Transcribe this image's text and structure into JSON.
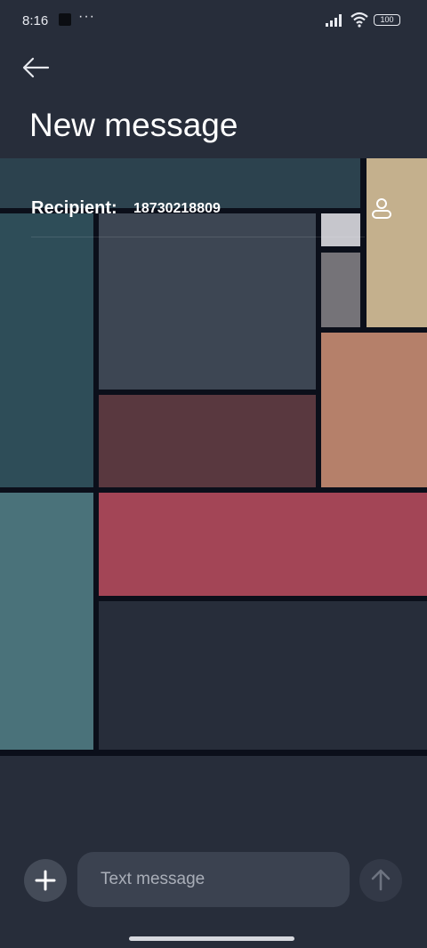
{
  "status_bar": {
    "time": "8:16",
    "overflow_indicator": "···",
    "battery": "100"
  },
  "header": {
    "title": "New message",
    "back_icon": "arrow-left-icon"
  },
  "recipient": {
    "label": "Recipient:",
    "value": "18730218809",
    "contact_icon": "person-icon"
  },
  "mosaic_colors": {
    "dark_teal": "#2c424e",
    "teal": "#2e4d58",
    "slate": "#3d4653",
    "light_gray": "#c6c6cc",
    "tan": "#c4b08d",
    "gray": "#757378",
    "maroon": "#59383f",
    "terracotta": "#b5806a",
    "sea_green": "#4a727a",
    "crimson": "#a34556",
    "navy": "#272d3a"
  },
  "composer": {
    "add_icon": "plus-icon",
    "placeholder": "Text message",
    "value": "",
    "send_icon": "arrow-up-icon"
  },
  "colors": {
    "background": "#272d3a",
    "input_background": "#3b4250",
    "text_primary": "#ffffff",
    "text_placeholder": "#a9aeb8"
  }
}
